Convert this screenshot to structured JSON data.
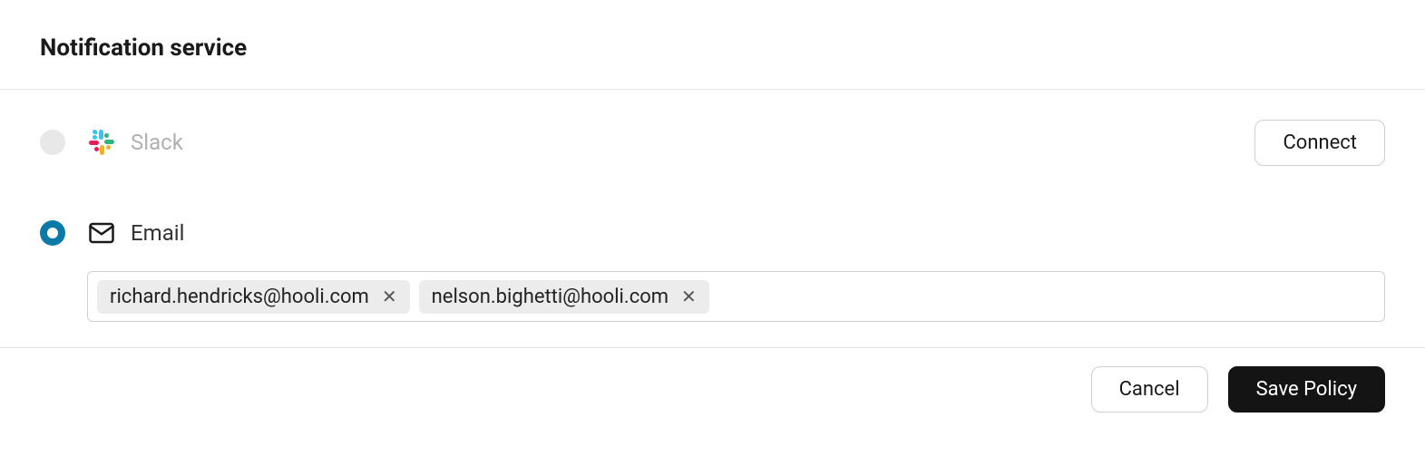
{
  "header": {
    "title": "Notification service"
  },
  "options": {
    "slack": {
      "label": "Slack",
      "connect_label": "Connect",
      "selected": false
    },
    "email": {
      "label": "Email",
      "selected": true,
      "chips": [
        "richard.hendricks@hooli.com",
        "nelson.bighetti@hooli.com"
      ]
    }
  },
  "footer": {
    "cancel_label": "Cancel",
    "save_label": "Save Policy"
  }
}
